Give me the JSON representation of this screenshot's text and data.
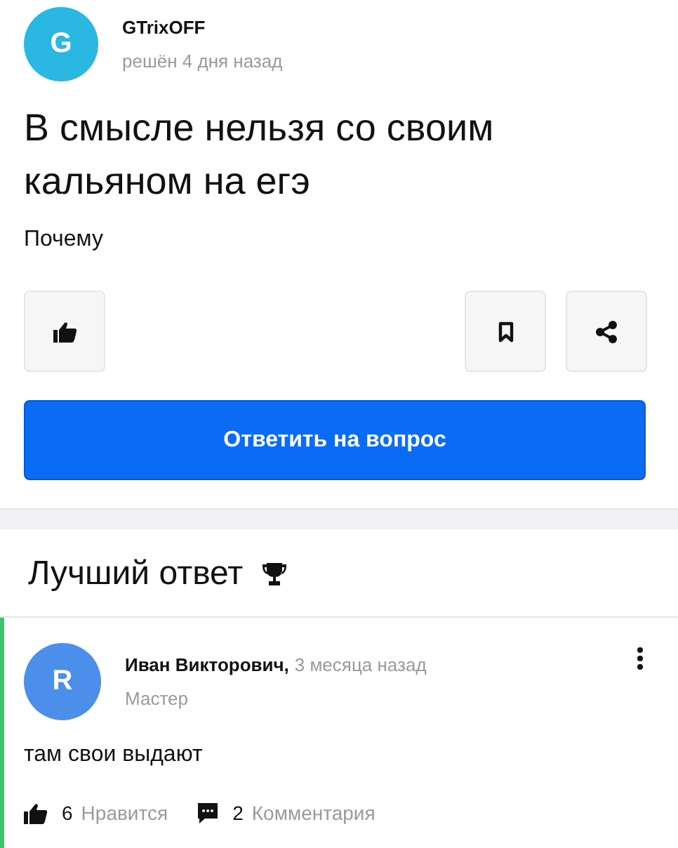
{
  "question": {
    "author": {
      "initial": "G",
      "name": "GTrixOFF",
      "meta": "решён 4 дня назад"
    },
    "title": "В смысле нельзя со своим кальяном на егэ",
    "body": "Почему",
    "actions": [
      {
        "kind": "like"
      },
      {
        "kind": "bookmark"
      },
      {
        "kind": "share"
      }
    ],
    "answer_button": "Ответить на вопрос"
  },
  "best_answer": {
    "heading": "Лучший ответ",
    "answer": {
      "author": {
        "initial": "R",
        "name": "Иван Викторович,",
        "time": "3 месяца назад",
        "rank": "Мастер"
      },
      "text": "там свои выдают",
      "likes": {
        "count": "6",
        "label": "Нравится"
      },
      "comments": {
        "count": "2",
        "label": "Комментария"
      }
    }
  }
}
